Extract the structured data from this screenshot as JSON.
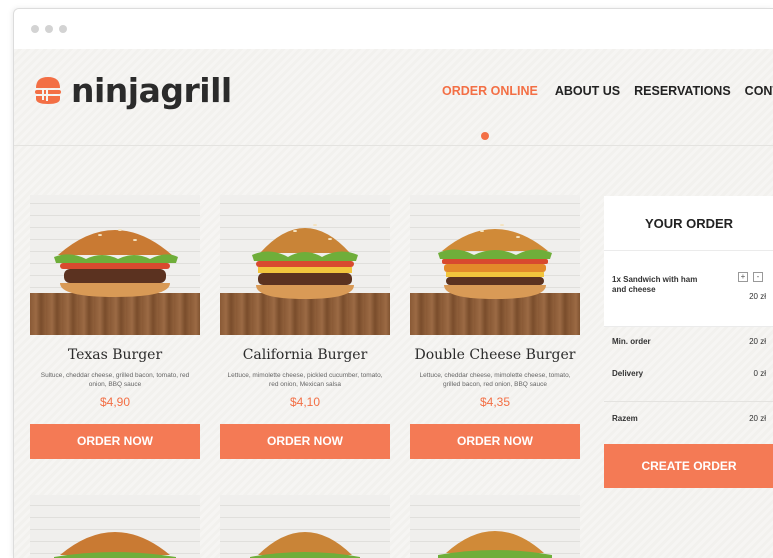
{
  "brand": {
    "name": "ninjagrill",
    "accent": "#f36f45"
  },
  "nav": {
    "items": [
      {
        "label": "ORDER ONLINE"
      },
      {
        "label": "ABOUT US"
      },
      {
        "label": "RESERVATIONS"
      },
      {
        "label": "CONTACT"
      }
    ]
  },
  "products": [
    {
      "title": "Texas Burger",
      "description": "Sultuce, cheddar cheese, grilled bacon, tomato, red onion, BBQ sauce",
      "price": "$4,90",
      "button": "ORDER NOW"
    },
    {
      "title": "California Burger",
      "description": "Lettuce, mimolette cheese, pickled cucumber, tomato, red onion, Mexican salsa",
      "price": "$4,10",
      "button": "ORDER NOW"
    },
    {
      "title": "Double Cheese Burger",
      "description": "Lettuce, cheddar cheese, mimolette cheese, tomato, grilled bacon, red onion, BBQ sauce",
      "price": "$4,35",
      "button": "ORDER NOW"
    }
  ],
  "order": {
    "title": "YOUR ORDER",
    "item": {
      "name": "1x Sandwich with ham and cheese",
      "price": "20 zł",
      "plus": "+",
      "minus": "-"
    },
    "min_order": {
      "label": "Min. order",
      "value": "20 zł"
    },
    "delivery": {
      "label": "Delivery",
      "value": "0 zł"
    },
    "total": {
      "label": "Razem",
      "value": "20 zł"
    },
    "button": "CREATE ORDER"
  }
}
